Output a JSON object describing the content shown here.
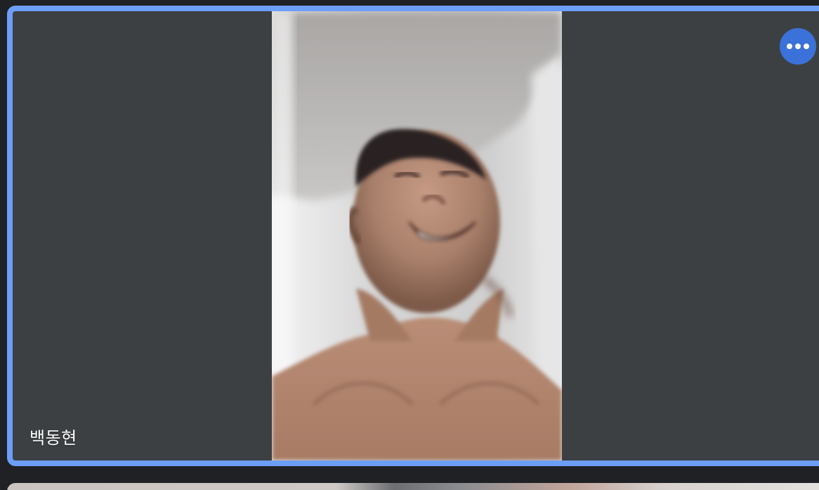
{
  "participant": {
    "name": "백동현",
    "video_icon": "participant-video",
    "more_icon": "more-options-icon"
  },
  "colors": {
    "active_border": "#6d9ef7",
    "tile_background": "#3c4043",
    "page_background": "#202124",
    "more_button": "#3b72d9"
  }
}
